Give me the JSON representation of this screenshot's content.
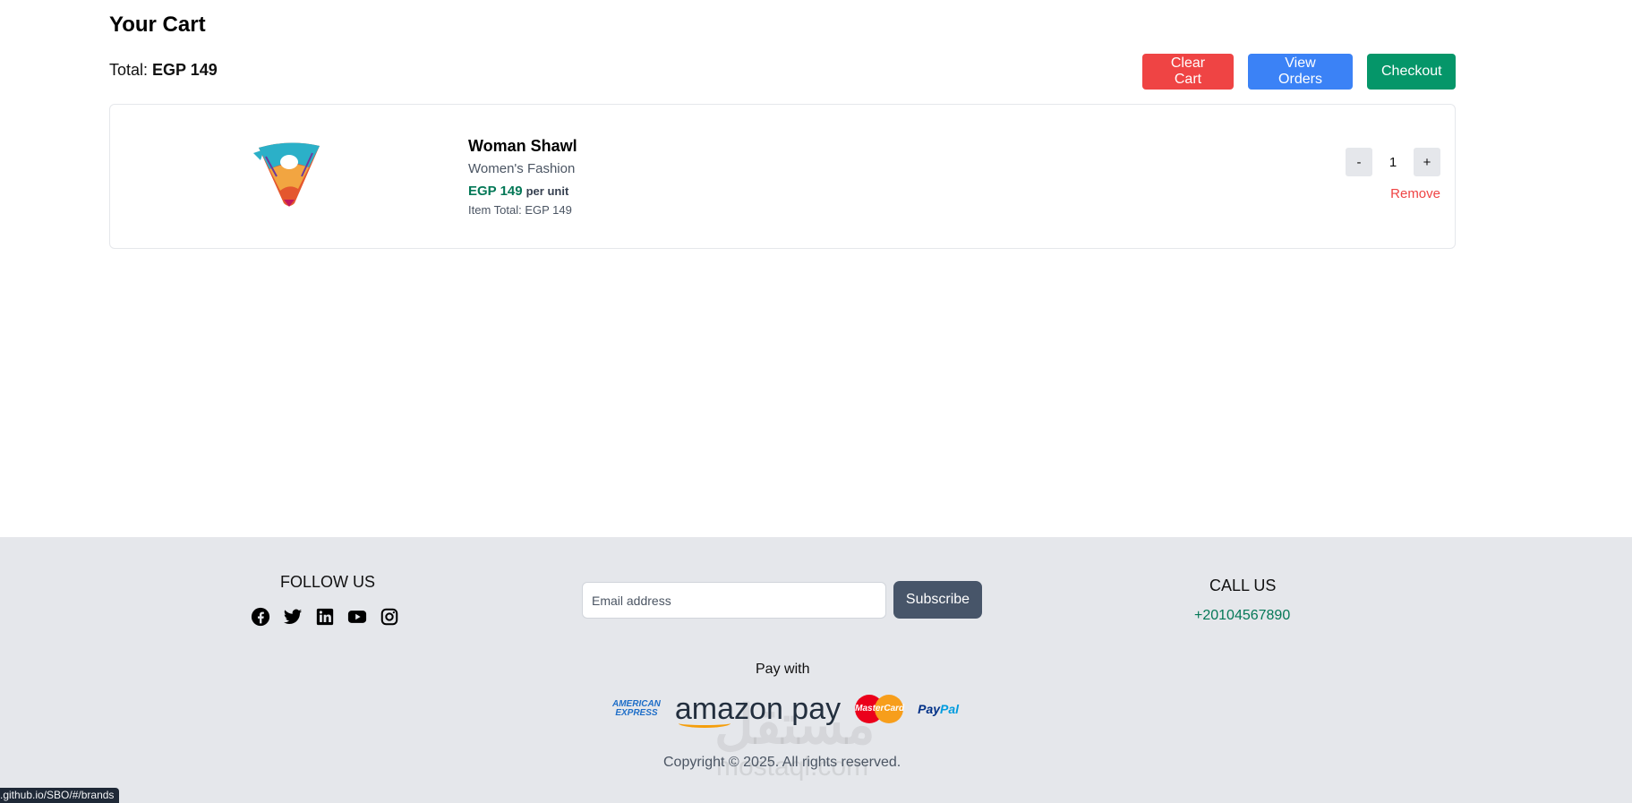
{
  "cart": {
    "title": "Your Cart",
    "total_label": "Total:",
    "total_value": "EGP 149",
    "buttons": {
      "clear": "Clear Cart",
      "orders": "View Orders",
      "checkout": "Checkout"
    },
    "items": [
      {
        "name": "Woman Shawl",
        "category": "Women's Fashion",
        "price": "EGP 149",
        "per_unit": "per unit",
        "item_total": "Item Total: EGP 149",
        "quantity": "1",
        "decrement": "-",
        "increment": "+",
        "remove": "Remove"
      }
    ]
  },
  "footer": {
    "follow_title": "FOLLOW US",
    "social_icons": [
      "facebook-icon",
      "twitter-icon",
      "linkedin-icon",
      "youtube-icon",
      "instagram-icon"
    ],
    "email_placeholder": "Email address",
    "subscribe": "Subscribe",
    "call_title": "CALL US",
    "phone": "+20104567890",
    "pay_with": "Pay with",
    "pay_logos": {
      "amex_line1": "AMERICAN",
      "amex_line2": "EXPRESS",
      "amazon_pay": "amazon pay",
      "mastercard": "MasterCard",
      "paypal_pay": "Pay",
      "paypal_pal": "Pal"
    },
    "copyright": "Copyright © 2025. All rights reserved.",
    "watermark": "مستقل",
    "watermark_domain": "mostaql.com"
  },
  "status_bar": {
    "url": ".github.io/SBO/#/brands"
  },
  "colors": {
    "clear": "#ef4444",
    "orders": "#3b82f6",
    "checkout": "#059669",
    "price_green": "#047857",
    "footer_bg": "#e5e7eb",
    "subscribe_bg": "#475569"
  }
}
